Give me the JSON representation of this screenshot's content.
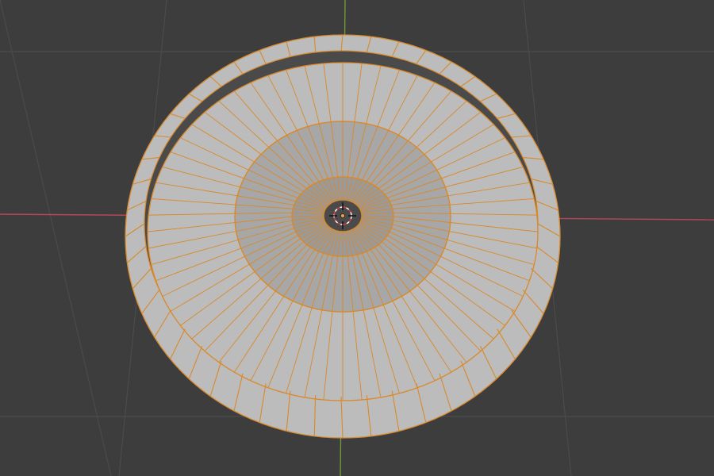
{
  "viewport": {
    "background": "#3d3d3d",
    "grid_color": "#4b4b4b",
    "x_axis_color": "#b8465a",
    "y_axis_color": "#6f9a34"
  },
  "mesh": {
    "name": "",
    "selected": true,
    "face_color": "#bcbcbc",
    "inner_face_color": "#a7a7a7",
    "edge_color": "#d9892a",
    "segments_outer": 48,
    "segments_inner": 64
  },
  "icons": {
    "origin": "origin-dot-icon",
    "cursor": "3d-cursor-icon"
  }
}
